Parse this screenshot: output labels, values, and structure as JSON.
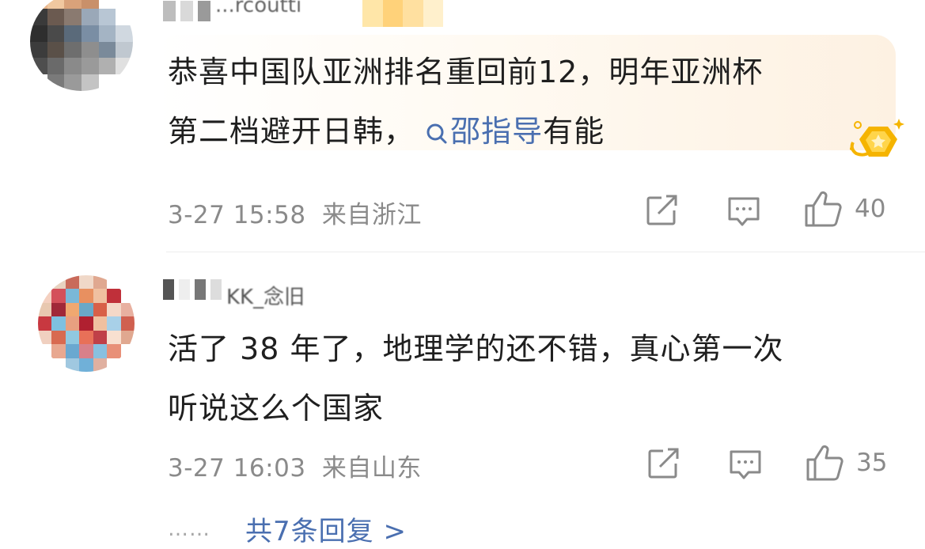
{
  "comments": [
    {
      "username": "...rcoutti",
      "text_lines": [
        "恭喜中国队亚洲排名重回前12，明年亚洲杯",
        "第二档避开日韩，"
      ],
      "link_text": "邵指导",
      "text_tail": "有能",
      "time": "3-27 15:58",
      "location": "来自浙江",
      "likes": "40"
    },
    {
      "username": "KK_念旧",
      "text_lines": [
        "活了 38 年了，地理学的还不错，真心第一次",
        "听说这么个国家"
      ],
      "time": "3-27 16:03",
      "location": "来自山东",
      "likes": "35"
    }
  ],
  "replies": {
    "dots": "……",
    "label": "共7条回复 >"
  },
  "colors": {
    "link": "#4a6fb0",
    "meta": "#8a8a8a",
    "bubble_tint": "#fdf1e2",
    "medal": "#f5b400"
  },
  "icons": [
    "share-icon",
    "comment-icon",
    "like-icon",
    "search-icon",
    "medal-icon"
  ]
}
